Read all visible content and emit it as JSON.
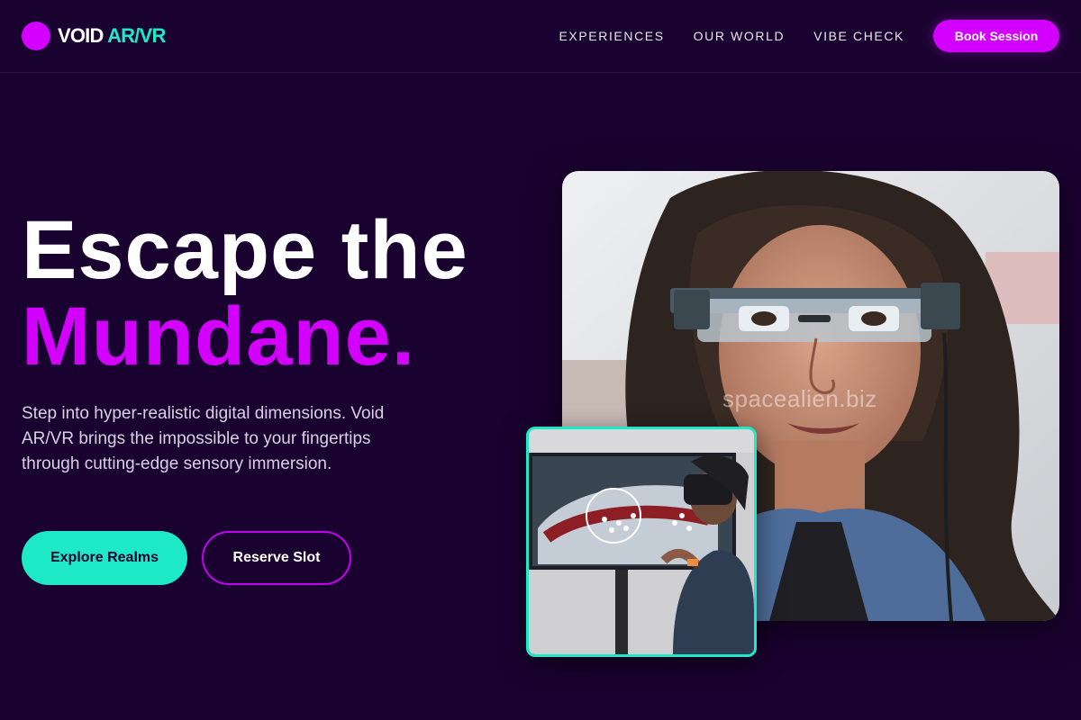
{
  "brand": {
    "name": "VOID",
    "accent": "AR/VR",
    "logo_color": "#d400ff",
    "accent_color": "#1de9c7"
  },
  "nav": {
    "links": [
      "EXPERIENCES",
      "OUR WORLD",
      "VIBE CHECK"
    ],
    "cta": "Book Session"
  },
  "hero": {
    "title_line1": "Escape the",
    "title_line2": "Mundane.",
    "subtitle": "Step into hyper-realistic digital dimensions. Void AR/VR brings the impossible to your fingertips through cutting-edge sensory immersion.",
    "primary_button": "Explore Realms",
    "secondary_button": "Reserve Slot"
  },
  "images": {
    "main_watermark": "spacealien.biz",
    "main_icon": "woman-wearing-ar-glasses-photo",
    "inset_icon": "person-using-vr-headset-photo"
  },
  "colors": {
    "background": "#1a0230",
    "primary": "#d400ff",
    "secondary": "#1de9c7"
  }
}
